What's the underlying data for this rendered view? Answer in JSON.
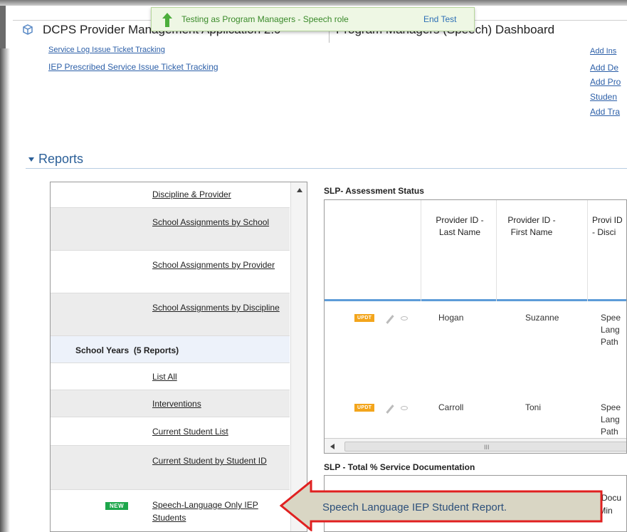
{
  "header": {
    "app_title": "DCPS Provider Management Application 2.0",
    "dashboard_title": "Program Managers (Speech) Dashboard"
  },
  "test_banner": {
    "message": "Testing as Program Managers - Speech role",
    "end_label": "End Test"
  },
  "top_links": {
    "left": [
      "Service Log Issue Ticket Tracking",
      "IEP Prescribed Service Issue Ticket Tracking"
    ],
    "right": [
      "Add Ins",
      "Add De",
      "Add Pro",
      "Studen",
      "Add Tra"
    ]
  },
  "reports": {
    "heading": "Reports",
    "items": [
      {
        "label": "Discipline & Provider"
      },
      {
        "label": "School Assignments by School"
      },
      {
        "label": "School Assignments by Provider"
      },
      {
        "label": "School Assignments by Discipline"
      },
      {
        "group": "School Years",
        "count_label": "(5 Reports)"
      },
      {
        "label": "List All"
      },
      {
        "label": "Interventions"
      },
      {
        "label": "Current Student List"
      },
      {
        "label": "Current Student by Student ID"
      },
      {
        "label": "Speech-Language Only IEP Students",
        "badge": "NEW"
      }
    ]
  },
  "assessment_grid": {
    "title": "SLP- Assessment Status",
    "columns": [
      "Provider ID - Last Name",
      "Provider ID - First Name",
      "Provi ID - Disci"
    ],
    "action_badge": "UPDT",
    "rows": [
      {
        "last": "Hogan",
        "first": "Suzanne",
        "discipline": "Spee Lang Path"
      },
      {
        "last": "Carroll",
        "first": "Toni",
        "discipline": "Spee Lang Path"
      }
    ],
    "scroll_grip": "III"
  },
  "documentation_grid": {
    "title": "SLP - Total % Service Documentation",
    "partial_header": "To Docu Min"
  },
  "callout": {
    "text": "Speech Language IEP Student Report.",
    "fill": "#d9d6c4",
    "border": "#e02020"
  }
}
